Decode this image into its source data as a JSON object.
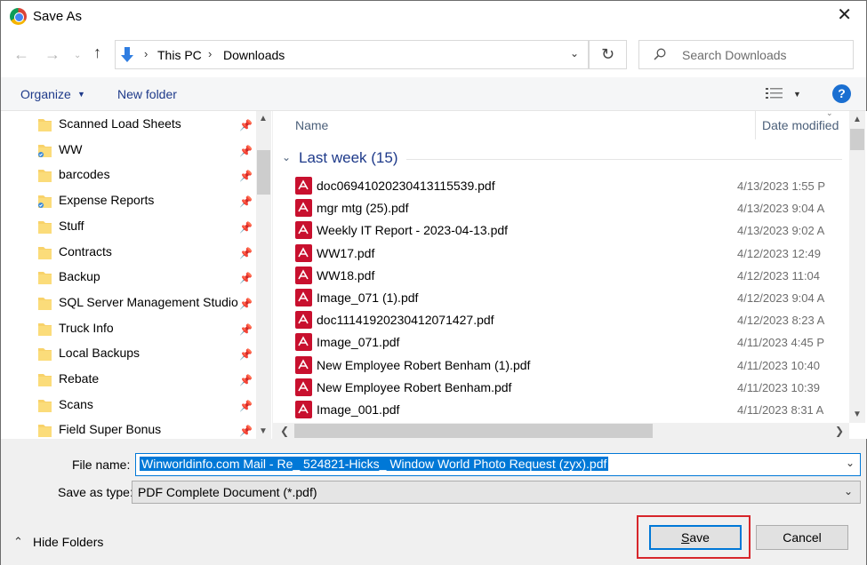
{
  "window": {
    "title": "Save As",
    "app_icon": "chrome-icon",
    "close_glyph": "✕"
  },
  "nav": {
    "back_glyph": "←",
    "forward_glyph": "→",
    "recent_glyph": "⌄",
    "up_glyph": "↑"
  },
  "address": {
    "location_icon": "downloads-arrow-icon",
    "breadcrumb": [
      "This PC",
      "Downloads"
    ],
    "separator": "›",
    "dropdown_glyph": "⌄",
    "refresh_glyph": "↻"
  },
  "search": {
    "placeholder": "Search Downloads"
  },
  "toolbar": {
    "organize": "Organize",
    "new_folder": "New folder",
    "help": "?"
  },
  "sidebar": {
    "items": [
      {
        "label": "Scanned Load Sheets",
        "pinned": true,
        "icon": "folder-icon"
      },
      {
        "label": "WW",
        "pinned": true,
        "icon": "shared-folder-icon"
      },
      {
        "label": "barcodes",
        "pinned": true,
        "icon": "folder-icon"
      },
      {
        "label": "Expense Reports",
        "pinned": true,
        "icon": "shared-folder-icon"
      },
      {
        "label": "Stuff",
        "pinned": true,
        "icon": "folder-icon"
      },
      {
        "label": "Contracts",
        "pinned": true,
        "icon": "folder-icon"
      },
      {
        "label": "Backup",
        "pinned": true,
        "icon": "folder-icon"
      },
      {
        "label": "SQL Server Management Studio",
        "pinned": true,
        "icon": "folder-icon"
      },
      {
        "label": "Truck Info",
        "pinned": true,
        "icon": "folder-icon"
      },
      {
        "label": "Local Backups",
        "pinned": true,
        "icon": "folder-icon"
      },
      {
        "label": "Rebate",
        "pinned": true,
        "icon": "folder-icon"
      },
      {
        "label": "Scans",
        "pinned": true,
        "icon": "folder-icon"
      },
      {
        "label": "Field Super Bonus",
        "pinned": true,
        "icon": "folder-icon"
      }
    ]
  },
  "file_list": {
    "columns": {
      "name": "Name",
      "date_modified": "Date modified"
    },
    "group": {
      "label": "Last week (15)"
    },
    "files": [
      {
        "name": "doc06941020230413115539.pdf",
        "date": "4/13/2023 1:55 P"
      },
      {
        "name": "mgr mtg (25).pdf",
        "date": "4/13/2023 9:04 A"
      },
      {
        "name": "Weekly IT Report - 2023-04-13.pdf",
        "date": "4/13/2023 9:02 A"
      },
      {
        "name": "WW17.pdf",
        "date": "4/12/2023 12:49"
      },
      {
        "name": "WW18.pdf",
        "date": "4/12/2023 11:04"
      },
      {
        "name": "Image_071 (1).pdf",
        "date": "4/12/2023 9:04 A"
      },
      {
        "name": "doc11141920230412071427.pdf",
        "date": "4/12/2023 8:23 A"
      },
      {
        "name": "Image_071.pdf",
        "date": "4/11/2023 4:45 P"
      },
      {
        "name": "New Employee Robert Benham (1).pdf",
        "date": "4/11/2023 10:40"
      },
      {
        "name": "New Employee Robert Benham.pdf",
        "date": "4/11/2023 10:39"
      },
      {
        "name": "Image_001.pdf",
        "date": "4/11/2023 8:31 A"
      }
    ]
  },
  "form": {
    "file_name_label": "File name:",
    "file_name_value": "Winworldinfo.com Mail - Re_ 524821-Hicks_ Window World Photo Request (zyx).pdf",
    "save_as_type_label": "Save as type:",
    "save_as_type_value": "PDF Complete Document (*.pdf)",
    "hide_folders": "Hide Folders",
    "save": "Save",
    "cancel": "Cancel"
  },
  "colors": {
    "accent": "#0078d7",
    "link_blue": "#1e3a8a",
    "highlight_red": "#d7262b",
    "pdf_red": "#c8102e"
  }
}
